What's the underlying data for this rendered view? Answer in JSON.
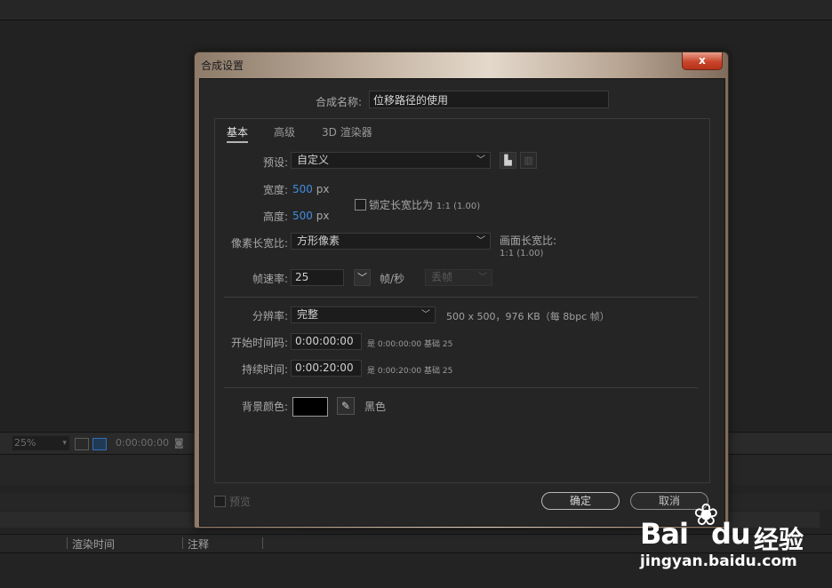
{
  "background": {
    "viewer_toolbar": {
      "zoom": "25%",
      "timecode": "0:00:00:00"
    },
    "columns": {
      "render_time": "渲染时间",
      "comment": "注释"
    }
  },
  "dialog": {
    "title": "合成设置",
    "close_label": "x",
    "name_label": "合成名称:",
    "name_value": "位移路径的使用",
    "tabs": [
      "基本",
      "高级",
      "3D 渲染器"
    ],
    "preset_label": "预设:",
    "preset_value": "自定义",
    "width_label": "宽度:",
    "width_value": "500",
    "height_label": "高度:",
    "height_value": "500",
    "px_unit": "px",
    "lock_aspect_label": "锁定长宽比为",
    "lock_aspect_value": "1:1 (1.00)",
    "pixel_aspect_label": "像素长宽比:",
    "pixel_aspect_value": "方形像素",
    "frame_aspect_label": "画面长宽比:",
    "frame_aspect_value": "1:1 (1.00)",
    "frame_rate_label": "帧速率:",
    "frame_rate_value": "25",
    "fps_unit": "帧/秒",
    "drop_frame_value": "丢帧",
    "resolution_label": "分辨率:",
    "resolution_value": "完整",
    "resolution_info": "500 x 500，976 KB（每 8bpc 帧）",
    "start_tc_label": "开始时间码:",
    "start_tc_value": "0:00:00:00",
    "start_tc_info": "是 0:00:00:00",
    "start_tc_base": "基础 25",
    "duration_label": "持续时间:",
    "duration_value": "0:00:20:00",
    "duration_info": "是 0:00:20:00",
    "duration_base": "基础 25",
    "bg_color_label": "背景颜色:",
    "bg_color_name": "黑色",
    "bg_color_hex": "#000000",
    "preview_label": "预览",
    "ok_label": "确定",
    "cancel_label": "取消"
  },
  "watermark": {
    "logo": "Bai",
    "logo_suffix": "du",
    "text": "经验",
    "url": "jingyan.baidu.com"
  }
}
